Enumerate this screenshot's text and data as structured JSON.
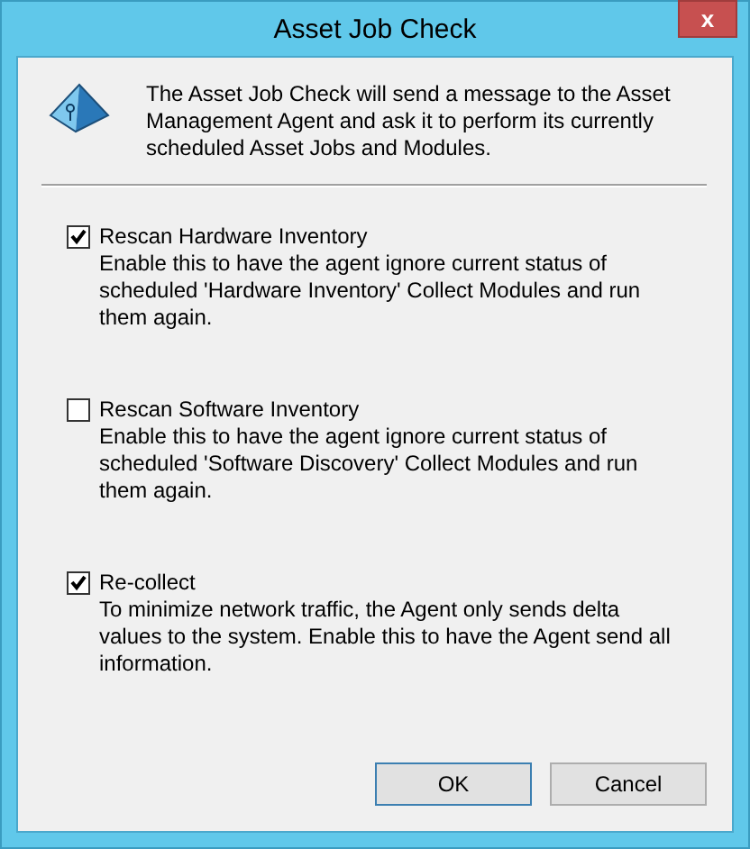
{
  "window": {
    "title": "Asset Job Check",
    "close": "x"
  },
  "intro": "The Asset Job Check will send a message to the Asset Management Agent and ask it to perform its currently scheduled Asset Jobs and Modules.",
  "options": [
    {
      "label": "Rescan Hardware Inventory",
      "description": "Enable this to have the agent ignore current status of scheduled 'Hardware Inventory' Collect Modules and run them again.",
      "checked": true
    },
    {
      "label": "Rescan Software Inventory",
      "description": "Enable this to have the agent ignore current status of scheduled 'Software Discovery' Collect Modules and run them again.",
      "checked": false
    },
    {
      "label": "Re-collect",
      "description": "To minimize network traffic, the Agent only sends delta values to the system. Enable this to have the Agent send all information.",
      "checked": true
    }
  ],
  "buttons": [
    "OK",
    "Cancel"
  ]
}
